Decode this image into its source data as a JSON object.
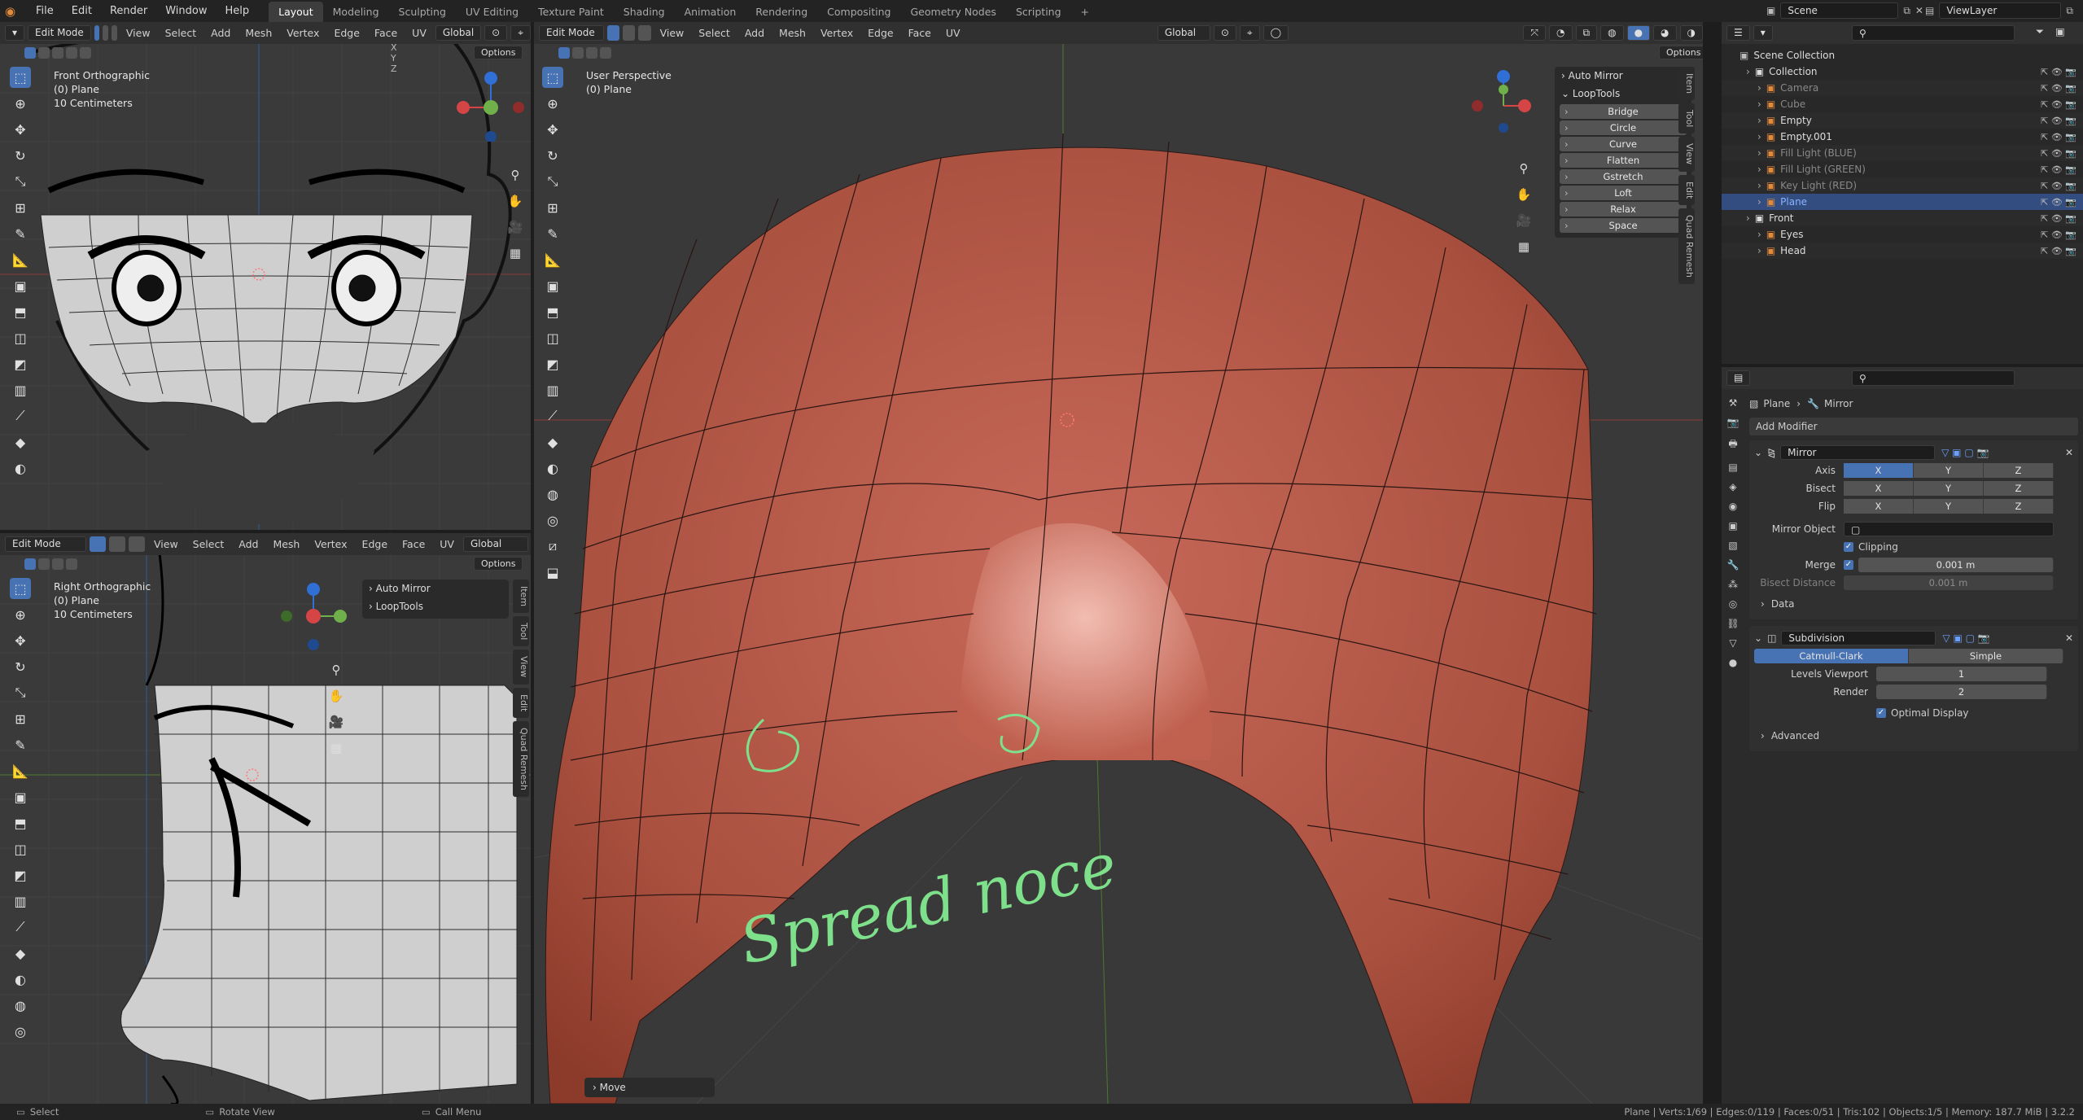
{
  "menu": [
    "File",
    "Edit",
    "Render",
    "Window",
    "Help"
  ],
  "workspaces": [
    "Layout",
    "Modeling",
    "Sculpting",
    "UV Editing",
    "Texture Paint",
    "Shading",
    "Animation",
    "Rendering",
    "Compositing",
    "Geometry Nodes",
    "Scripting"
  ],
  "active_workspace": "Layout",
  "scene_name": "Scene",
  "view_layer": "ViewLayer",
  "viewport_menus": [
    "View",
    "Select",
    "Add",
    "Mesh",
    "Vertex",
    "Edge",
    "Face",
    "UV"
  ],
  "mode": "Edit Mode",
  "transform": "Global",
  "options": "Options",
  "axis_letters": [
    "X",
    "Y",
    "Z"
  ],
  "vp_front": {
    "title": "Front Orthographic",
    "object": "(0) Plane",
    "scale": "10 Centimeters"
  },
  "vp_right": {
    "title": "Right Orthographic",
    "object": "(0) Plane",
    "scale": "10 Centimeters"
  },
  "vp_main": {
    "title": "User Perspective",
    "object": "(0) Plane"
  },
  "npanel_tabs": [
    "Item",
    "Tool",
    "View",
    "Edit",
    "Quad Remesh"
  ],
  "auto_mirror": "Auto Mirror",
  "looptools": {
    "title": "LoopTools",
    "items": [
      "Bridge",
      "Circle",
      "Curve",
      "Flatten",
      "Gstretch",
      "Loft",
      "Relax",
      "Space"
    ]
  },
  "annotation": "Spread  noce",
  "last_op": "Move",
  "outliner": {
    "root": "Scene Collection",
    "rows": [
      {
        "label": "Collection",
        "depth": 1
      },
      {
        "label": "Camera",
        "depth": 2,
        "dim": true
      },
      {
        "label": "Cube",
        "depth": 2,
        "dim": true
      },
      {
        "label": "Empty",
        "depth": 2
      },
      {
        "label": "Empty.001",
        "depth": 2
      },
      {
        "label": "Fill Light (BLUE)",
        "depth": 2,
        "dim": true
      },
      {
        "label": "Fill Light (GREEN)",
        "depth": 2,
        "dim": true
      },
      {
        "label": "Key Light (RED)",
        "depth": 2,
        "dim": true
      },
      {
        "label": "Plane",
        "depth": 2,
        "selected": true
      },
      {
        "label": "Front",
        "depth": 1
      },
      {
        "label": "Eyes",
        "depth": 2
      },
      {
        "label": "Head",
        "depth": 2
      }
    ]
  },
  "props": {
    "breadcrumb_object": "Plane",
    "breadcrumb_modifier": "Mirror",
    "add_modifier": "Add Modifier",
    "mirror": {
      "name": "Mirror",
      "axis_label": "Axis",
      "bisect_label": "Bisect",
      "flip_label": "Flip",
      "mirror_object_label": "Mirror Object",
      "clipping": "Clipping",
      "merge_label": "Merge",
      "merge_value": "0.001 m",
      "bisect_distance_label": "Bisect Distance",
      "bisect_distance_value": "0.001 m",
      "data": "Data"
    },
    "subdivision": {
      "name": "Subdivision",
      "catmull": "Catmull-Clark",
      "simple": "Simple",
      "levels_label": "Levels Viewport",
      "levels_value": "1",
      "render_label": "Render",
      "render_value": "2",
      "optimal": "Optimal Display",
      "advanced": "Advanced"
    }
  },
  "status": {
    "select": "Select",
    "rotate": "Rotate View",
    "call_menu": "Call Menu",
    "stats": "Plane | Verts:1/69 | Edges:0/119 | Faces:0/51 | Tris:102 | Objects:1/5 | Memory: 187.7 MiB | 3.2.2"
  },
  "colors": {
    "accent": "#4772b3",
    "mesh": "#b5584a",
    "annotation": "#7ee08a"
  }
}
